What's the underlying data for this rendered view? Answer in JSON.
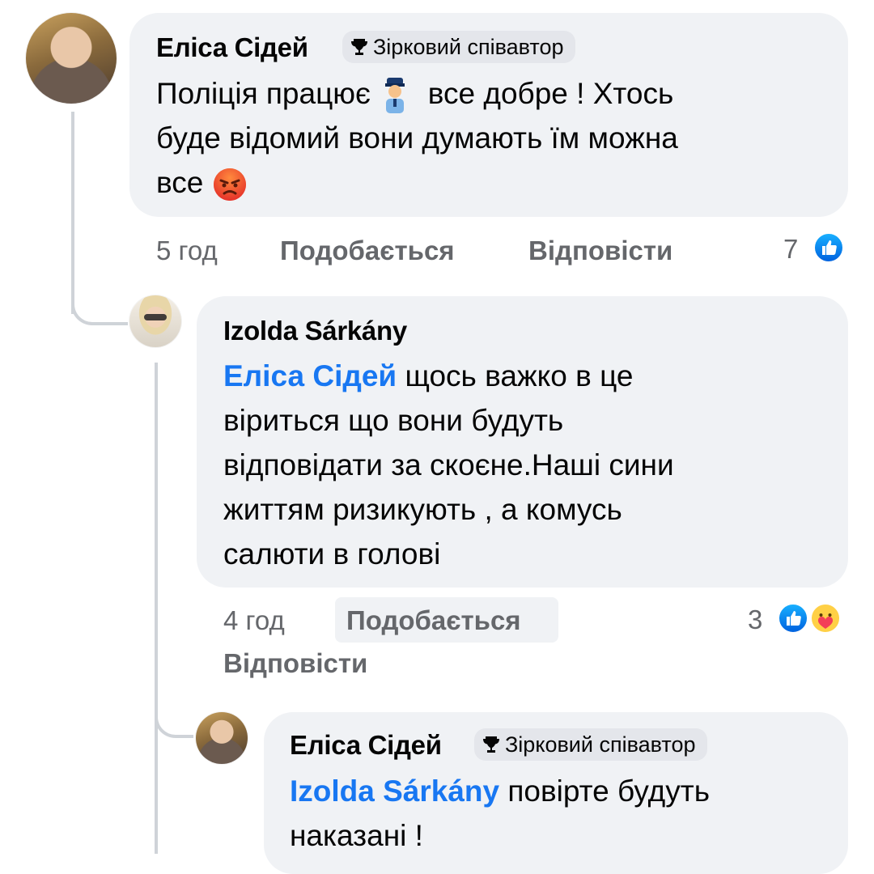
{
  "comments": [
    {
      "author": "Еліса Сідей",
      "badge": "Зірковий співавтор",
      "text_lines": [
        "Поліція працює",
        "все добре ! Хтось",
        "буде відомий вони думають їм можна",
        "все"
      ],
      "time": "5 год",
      "like_label": "Подобається",
      "reply_label": "Відповісти",
      "reaction_count": "7",
      "reactions": [
        "like-icon"
      ]
    },
    {
      "author": "Izolda Sárkány",
      "mention": "Еліса Сідей",
      "text_first": "щось важко в це",
      "text_lines": [
        "віриться що  вони будуть",
        "відповідати за скоєне.Наші сини",
        "життям ризикують , а комусь",
        "салюти в голові"
      ],
      "time": "4 год",
      "like_label": "Подобається",
      "reply_label": "Відповісти",
      "reaction_count": "3",
      "reactions": [
        "like-icon",
        "care-icon"
      ]
    },
    {
      "author": "Еліса Сідей",
      "badge": "Зірковий співавтор",
      "mention": "Izolda Sárkány",
      "text_first": "повірте будуть",
      "text_lines": [
        "наказані !"
      ]
    }
  ],
  "colors": {
    "bubble": "#f0f2f5",
    "mention": "#1877f2",
    "meta": "#65676b",
    "thread_line": "#cfd3d8"
  },
  "icons": [
    "trophy-icon",
    "police-officer-emoji",
    "angry-face-emoji",
    "like-icon",
    "care-icon"
  ]
}
